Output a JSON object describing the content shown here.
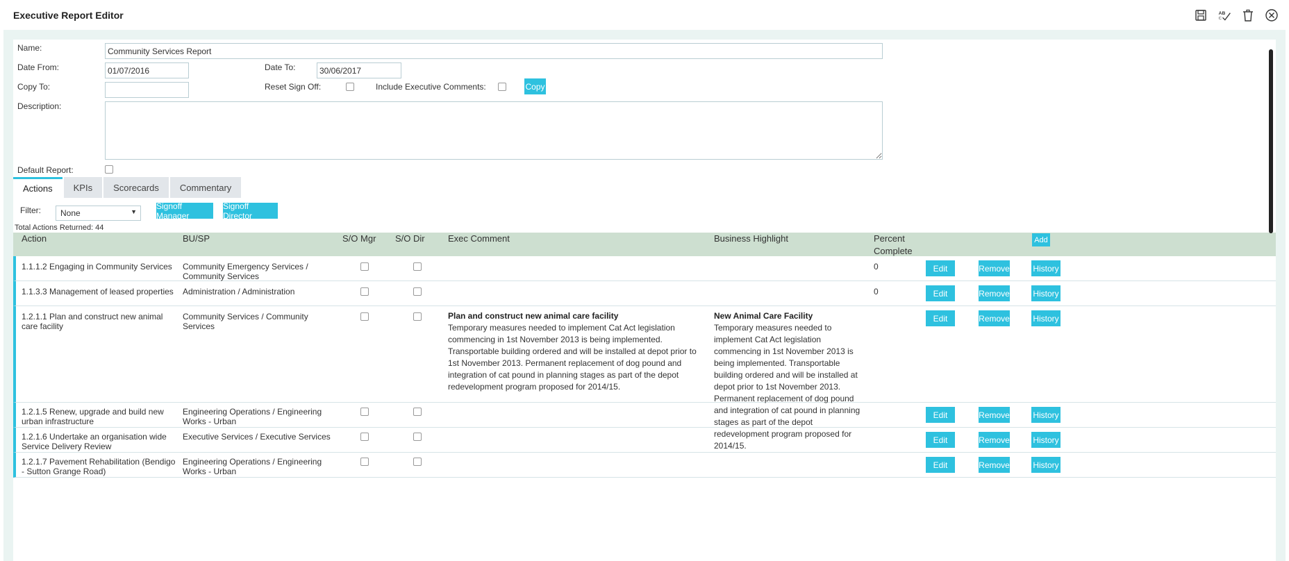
{
  "window": {
    "title": "Executive Report Editor"
  },
  "form": {
    "name_label": "Name:",
    "name_value": "Community Services Report",
    "date_from_label": "Date From:",
    "date_from_value": "01/07/2016",
    "date_to_label": "Date To:",
    "date_to_value": "30/06/2017",
    "copy_to_label": "Copy To:",
    "copy_to_value": "",
    "reset_signoff_label": "Reset Sign Off:",
    "include_exec_label": "Include Executive Comments:",
    "copy_button": "Copy",
    "description_label": "Description:",
    "description_value": "",
    "default_report_label": "Default Report:"
  },
  "tabs": [
    {
      "label": "Actions"
    },
    {
      "label": "KPIs"
    },
    {
      "label": "Scorecards"
    },
    {
      "label": "Commentary"
    }
  ],
  "filter": {
    "label": "Filter:",
    "value": "None",
    "signoff_manager": "Signoff Manager",
    "signoff_director": "Signoff Director",
    "total": "Total Actions Returned: 44"
  },
  "table": {
    "headers": {
      "action": "Action",
      "busp": "BU/SP",
      "so_mgr": "S/O Mgr",
      "so_dir": "S/O Dir",
      "exec_comment": "Exec Comment",
      "business_highlight": "Business Highlight",
      "percent_complete": "Percent Complete",
      "add": "Add"
    },
    "buttons": {
      "edit": "Edit",
      "remove": "Remove",
      "history": "History"
    },
    "rows": [
      {
        "action": "1.1.1.2 Engaging in Community Services",
        "busp": "Community Emergency Services / Community Services",
        "exec_title": "",
        "exec_body": "",
        "hl_title": "",
        "hl_body": "",
        "percent": "0"
      },
      {
        "action": "1.1.3.3 Management of leased properties",
        "busp": "Administration / Administration",
        "exec_title": "",
        "exec_body": "",
        "hl_title": "",
        "hl_body": "",
        "percent": "0"
      },
      {
        "action": "1.2.1.1 Plan and construct new animal care facility",
        "busp": "Community Services / Community Services",
        "exec_title": "Plan and construct new animal care facility",
        "exec_body": "Temporary measures needed to implement Cat Act legislation commencing in 1st November 2013 is being implemented. Transportable building ordered and will be installed at depot prior to 1st November 2013. Permanent replacement of dog pound and integration of cat pound in planning stages as part of the depot redevelopment program proposed for 2014/15.",
        "hl_title": "New Animal Care Facility",
        "hl_body": "Temporary measures needed to implement Cat Act legislation commencing in 1st November 2013 is being implemented. Transportable building ordered and will be installed at depot prior to 1st November 2013. Permanent replacement of dog pound and integration of cat pound in planning stages as part of the depot redevelopment program proposed for 2014/15.",
        "percent": ""
      },
      {
        "action": "1.2.1.5 Renew, upgrade and build new urban infrastructure",
        "busp": "Engineering Operations / Engineering Works - Urban",
        "exec_title": "",
        "exec_body": "",
        "hl_title": "",
        "hl_body": "",
        "percent": ""
      },
      {
        "action": "1.2.1.6 Undertake an organisation wide Service Delivery Review",
        "busp": "Executive Services / Executive Services",
        "exec_title": "",
        "exec_body": "",
        "hl_title": "",
        "hl_body": "",
        "percent": ""
      },
      {
        "action": "1.2.1.7 Pavement Rehabilitation (Bendigo - Sutton Grange Road)",
        "busp": "Engineering Operations / Engineering Works - Urban",
        "exec_title": "",
        "exec_body": "",
        "hl_title": "",
        "hl_body": "",
        "percent": ""
      }
    ]
  },
  "colors": {
    "accent": "#2ec1df",
    "header_bg": "#cddfd0",
    "panel_bg": "#eaf4f2"
  }
}
